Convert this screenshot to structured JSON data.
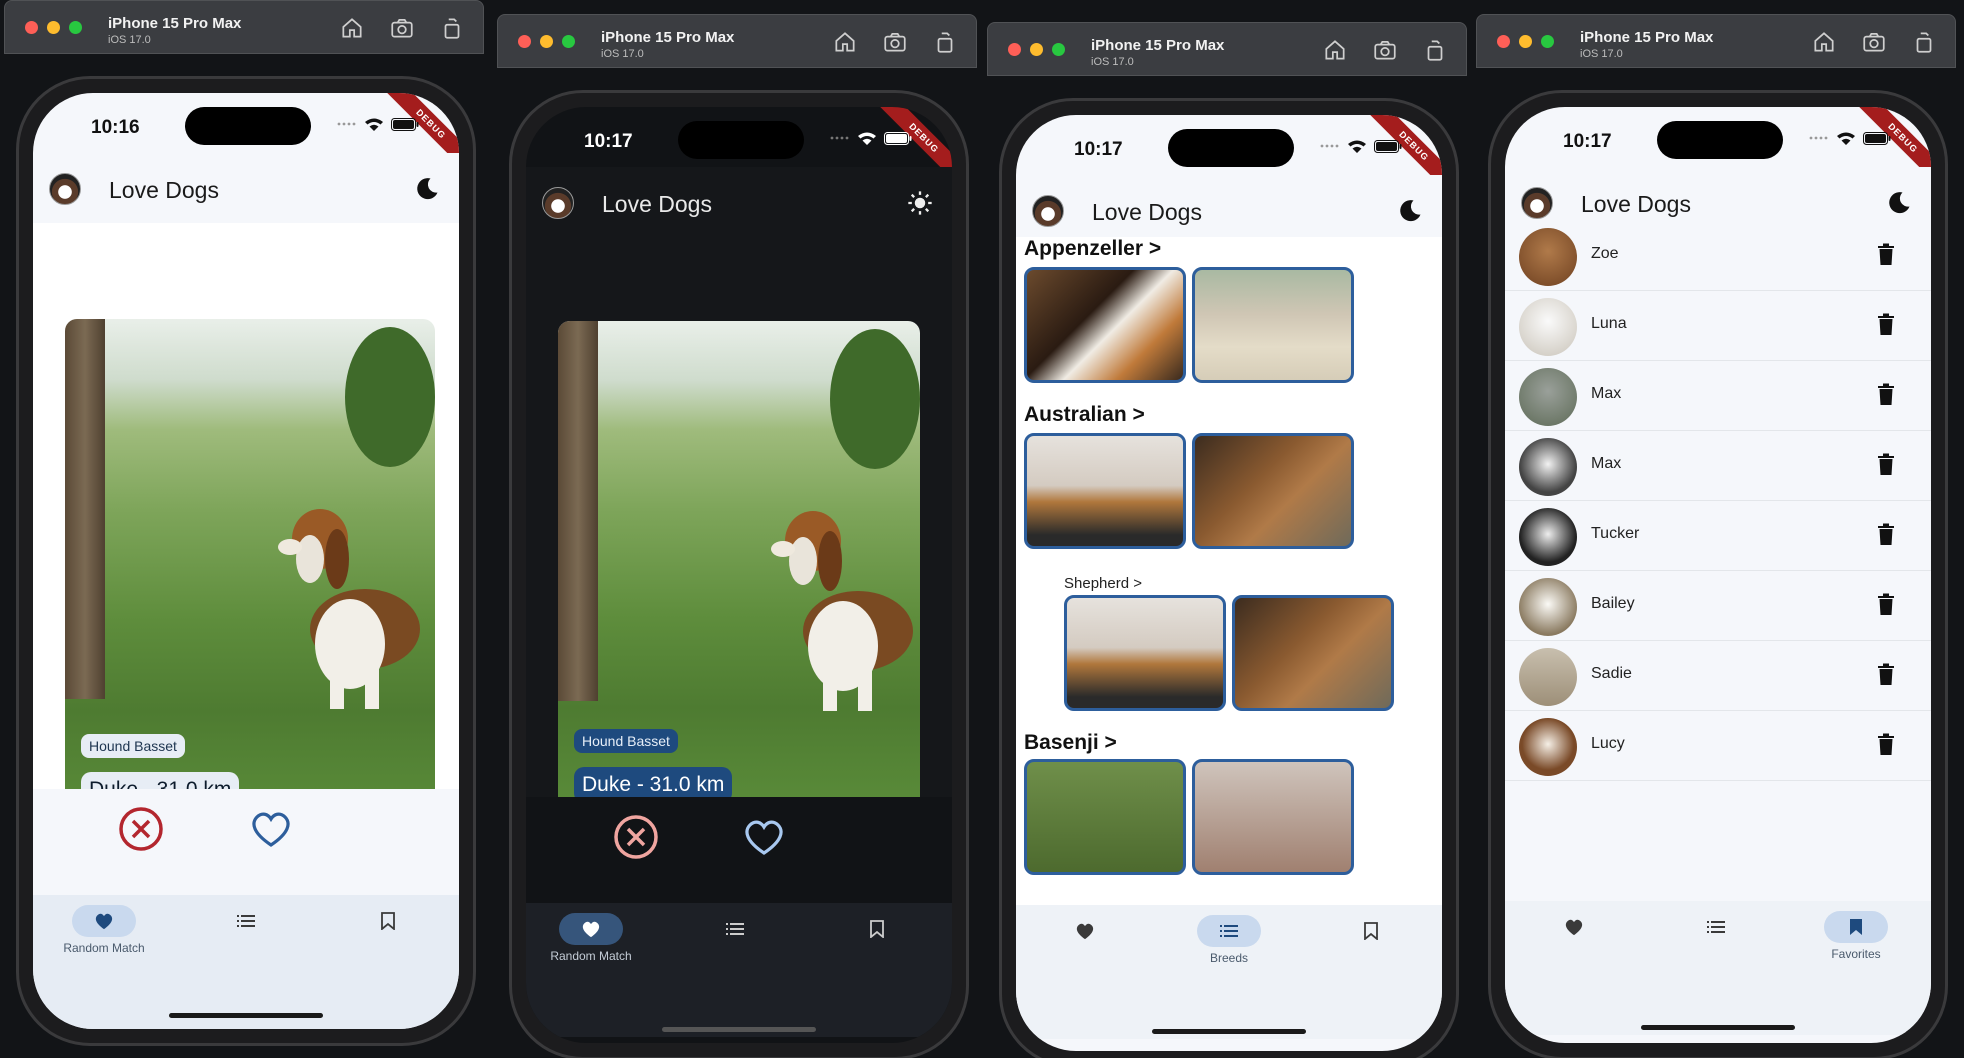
{
  "device": {
    "name": "iPhone 15 Pro Max",
    "os": "iOS 17.0"
  },
  "debug_label": "DEBUG",
  "app": {
    "title": "Love Dogs"
  },
  "screens": [
    {
      "time": "10:16",
      "theme": "light"
    },
    {
      "time": "10:17",
      "theme": "dark"
    },
    {
      "time": "10:17",
      "theme": "light"
    },
    {
      "time": "10:17",
      "theme": "light"
    }
  ],
  "match_card": {
    "breed": "Hound Basset",
    "title": "Duke - 31.0 km"
  },
  "nav": {
    "random_match": "Random Match",
    "breeds": "Breeds",
    "favorites": "Favorites"
  },
  "breeds": [
    {
      "title": "Appenzeller >"
    },
    {
      "title": "Australian >",
      "sub": "Shepherd >"
    },
    {
      "title": "Basenji >"
    }
  ],
  "favorites": [
    "Zoe",
    "Luna",
    "Max",
    "Max",
    "Tucker",
    "Bailey",
    "Sadie",
    "Lucy"
  ],
  "colors": {
    "accent": "#2d5e9c",
    "reject": "#b3262e",
    "like": "#2d5e9c",
    "nav_active": "#c9d9ee"
  }
}
